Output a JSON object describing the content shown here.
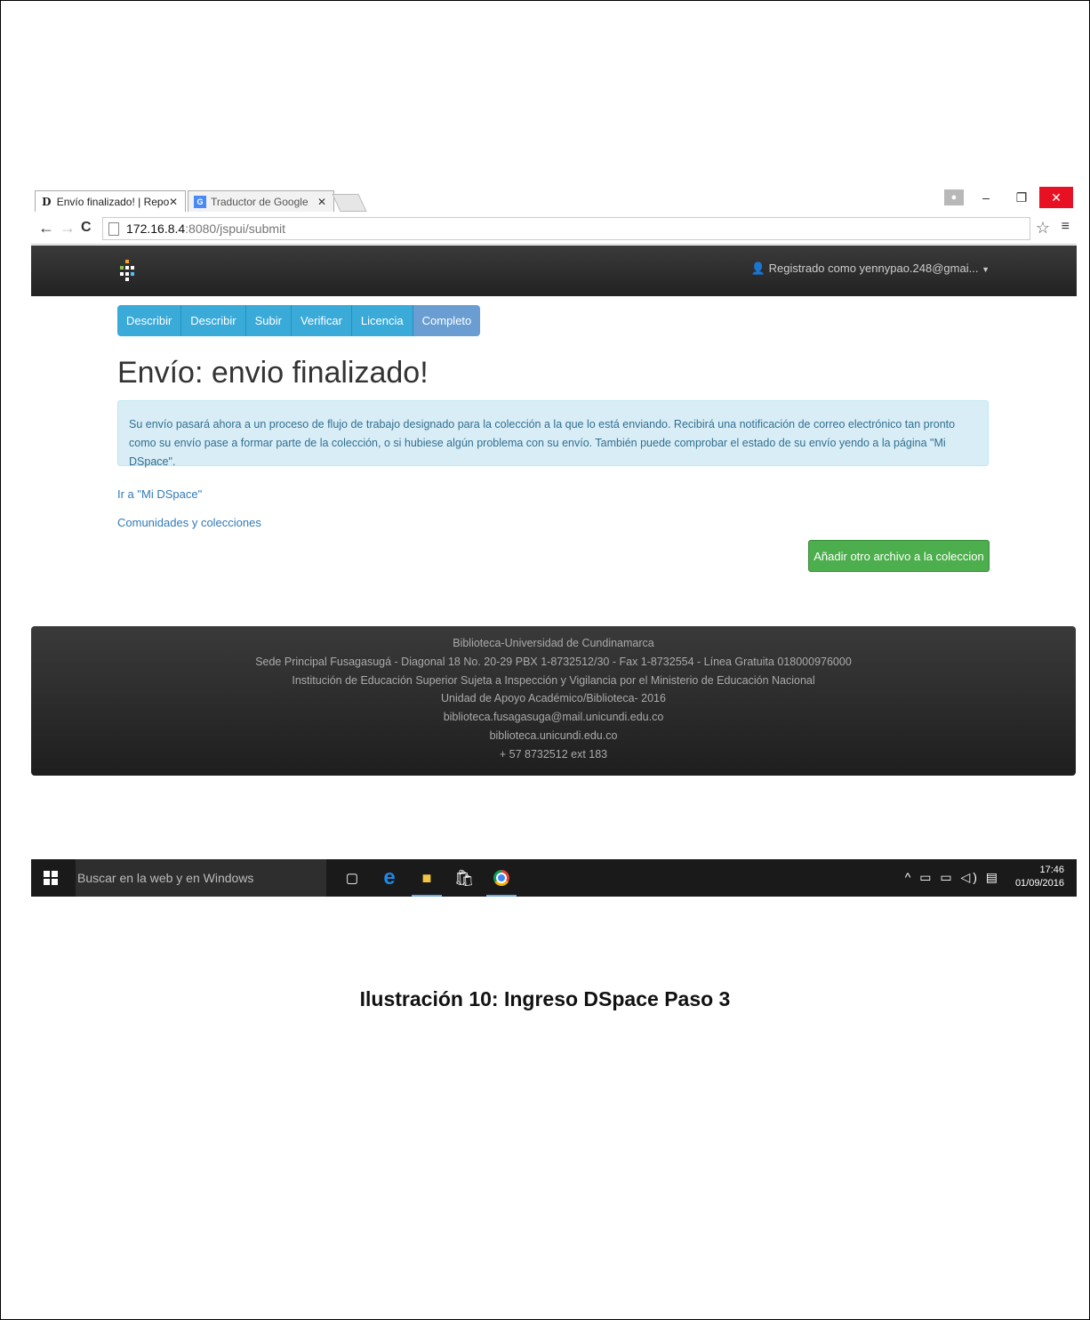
{
  "browser": {
    "tabs": [
      {
        "label": "Envío finalizado! | Reposit",
        "icon": "dspace-favicon"
      },
      {
        "label": "Traductor de Google",
        "icon": "google-translate-favicon"
      }
    ],
    "url_host": "172.16.8.4",
    "url_path": ":8080/jspui/submit"
  },
  "navbar": {
    "user_label": "Registrado como yennypao.248@gmai..."
  },
  "steps": [
    "Describir",
    "Describir",
    "Subir",
    "Verificar",
    "Licencia",
    "Completo"
  ],
  "main": {
    "title": "Envío: envio finalizado!",
    "alert_text": "Su envío pasará ahora a un proceso de flujo de trabajo designado para la colección a la que lo está enviando. Recibirá una notificación de correo electrónico tan pronto como su envío pase a formar parte de la colección, o si hubiese algún problema con su envío. También puede comprobar el estado de su envío yendo a la página \"Mi DSpace\".",
    "link_mydspace": "Ir a \"Mi DSpace\"",
    "link_communities": "Comunidades y colecciones",
    "add_button": "Añadir otro archivo a la coleccion"
  },
  "footer": {
    "lines": [
      "Biblioteca-Universidad de Cundinamarca",
      "Sede Principal Fusagasugá - Diagonal 18 No. 20-29 PBX 1-8732512/30 - Fax 1-8732554 - Línea Gratuita 018000976000",
      "Institución de Educación Superior Sujeta a Inspección y Vigilancia por el Ministerio de Educación Nacional",
      "Unidad de Apoyo Académico/Biblioteca- 2016",
      "biblioteca.fusagasuga@mail.unicundi.edu.co",
      "biblioteca.unicundi.edu.co",
      "+ 57 8732512 ext 183"
    ]
  },
  "taskbar": {
    "search_placeholder": "Buscar en la web y en Windows",
    "time": "17:46",
    "date": "01/09/2016"
  },
  "caption": "Ilustración 10: Ingreso DSpace Paso 3",
  "colors": {
    "step_blue": "#3aaad9",
    "step_current": "#6a9ed2",
    "success_green": "#4cae4c",
    "alert_bg": "#d9edf7",
    "close_red": "#e81123"
  }
}
